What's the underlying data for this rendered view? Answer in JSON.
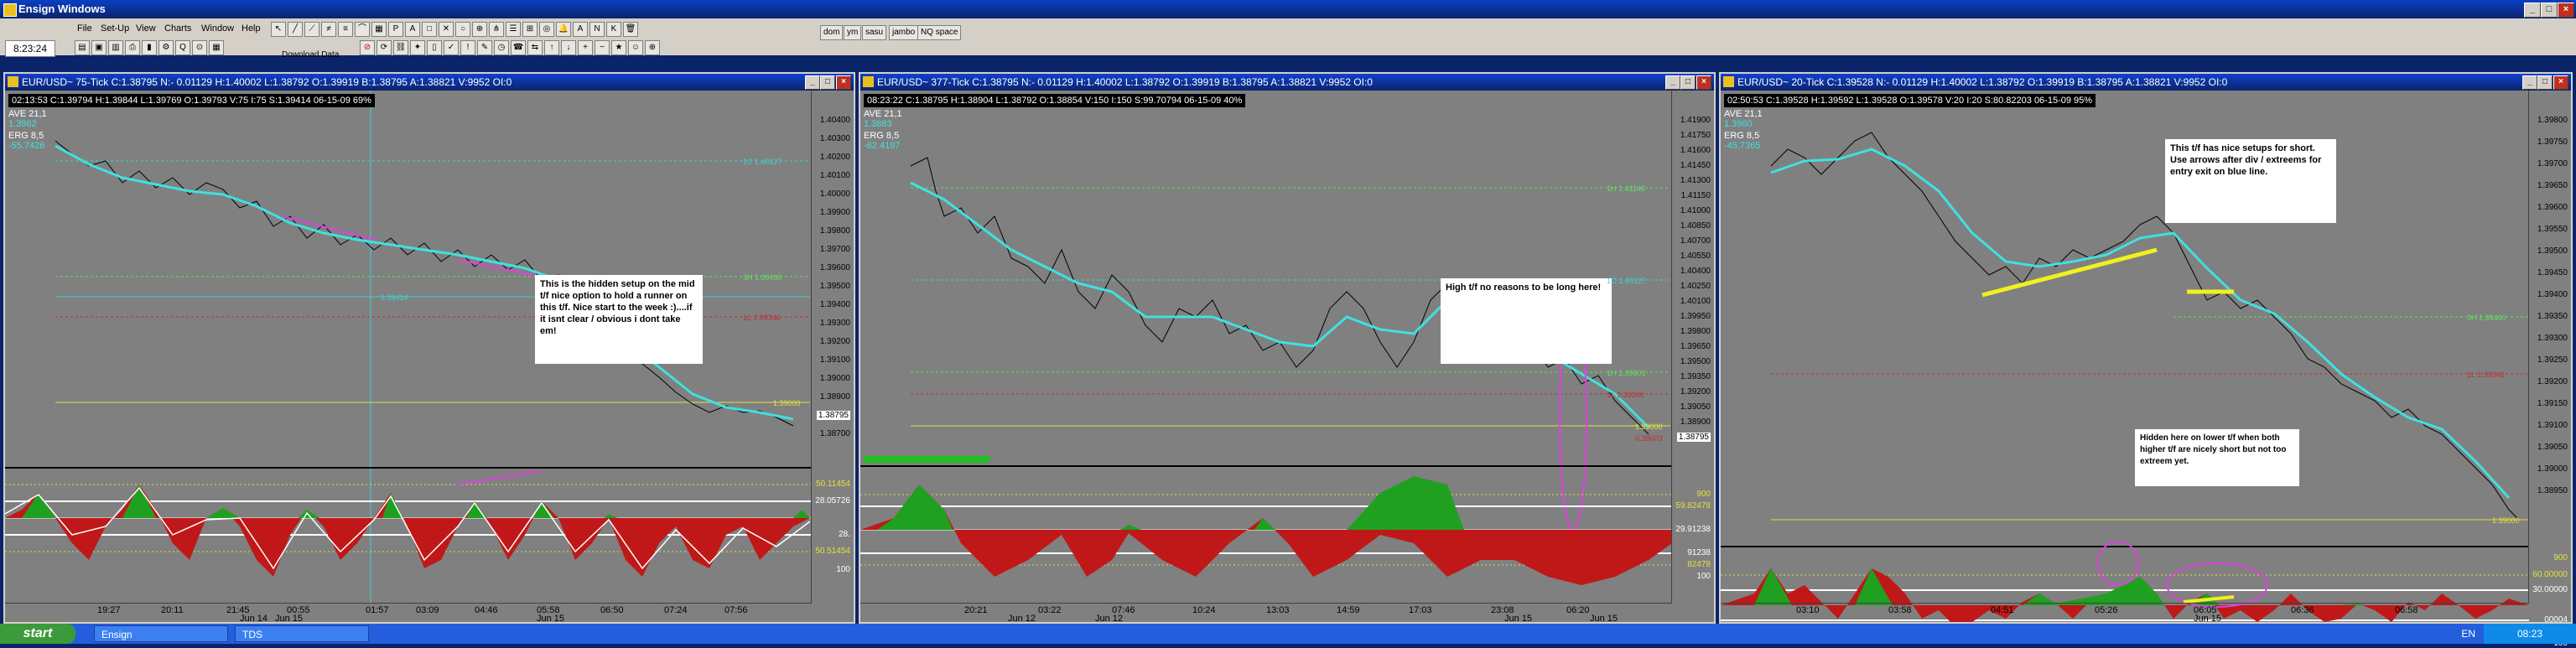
{
  "app": {
    "title": "Ensign Windows",
    "clock": "8:23:24",
    "download_label": "Download Data"
  },
  "menu": [
    "File",
    "Set-Up",
    "View",
    "Charts",
    "Window",
    "Help"
  ],
  "toolbar_tabs": [
    "dom",
    "ym",
    "sasu",
    "jambo",
    "NQ space"
  ],
  "toolbar_letters": [
    "A",
    "N",
    "K",
    "P"
  ],
  "charts": [
    {
      "title": "EUR/USD~ 75-Tick C:1.38795 N:- 0.01129 H:1.40002 L:1.38792 O:1.39919 B:1.38795 A:1.38821 V:9952 OI:0",
      "info": "02:13:53  C:1.39794  H:1.39844  L:1.39769  O:1.39793  V:75  I:75  S:1.39414  06-15-09   69%",
      "ave_label": "AVE 21,1",
      "ave_value": "1.3962",
      "erg_label": "ERG 8,5",
      "erg_value": "-55.7426",
      "prices": [
        "1.40400",
        "1.40300",
        "1.40200",
        "1.40100",
        "1.40000",
        "1.39900",
        "1.39800",
        "1.39700",
        "1.39600",
        "1.39500",
        "1.39400",
        "1.39300",
        "1.39200",
        "1.39100",
        "1.39000",
        "1.38900",
        "1.38795",
        "1.38700"
      ],
      "osc_labels": [
        "50.11454",
        "28.05726",
        "28.",
        "50.51454",
        "100"
      ],
      "xticks": [
        "19:27",
        "20:11",
        "21:45",
        "00:55",
        "01:57",
        "03:09",
        "04:46",
        "05:58",
        "06:50",
        "07:24",
        "07:56"
      ],
      "xsubs": [
        "Jun 14",
        "Jun 15",
        "Jun 15"
      ],
      "levels": [
        "1C 1.40127",
        "1.39414",
        "3H 1.39460",
        "1L 1.39346",
        "1.39000"
      ],
      "note": "This is the hidden setup on the mid t/f nice option to hold a runner on this t/f. Nice start to the week :)....if it isnt clear / obvious i dont take em!"
    },
    {
      "title": "EUR/USD~ 377-Tick C:1.38795 N:- 0.01129 H:1.40002 L:1.38792 O:1.39919 B:1.38795 A:1.38821 V:9952 OI:0",
      "info": "08:23:22  C:1.38795  H:1.38904  L:1.38792  O:1.38854  V:150  I:150  S:99.70794  06-15-09   40%",
      "ave_label": "AVE 21,1",
      "ave_value": "1.3883",
      "erg_label": "ERG 8,5",
      "erg_value": "-62.4197",
      "prices": [
        "1.41900",
        "1.41750",
        "1.41600",
        "1.41450",
        "1.41300",
        "1.41150",
        "1.41000",
        "1.40850",
        "1.40700",
        "1.40550",
        "1.40400",
        "1.40250",
        "1.40100",
        "1.39950",
        "1.39800",
        "1.39650",
        "1.39500",
        "1.39350",
        "1.39200",
        "1.39050",
        "1.38900",
        "1.38795"
      ],
      "osc_labels": [
        "900",
        "59.82478",
        "29.91238",
        "91238",
        "82478",
        "100"
      ],
      "xticks": [
        "20:21",
        "03:22",
        "07:46",
        "10:24",
        "13:03",
        "14:59",
        "17:03",
        "23:08",
        "06:20"
      ],
      "xsubs": [
        "Jun 12",
        "Jun 12",
        "Jun 15",
        "Jun 15"
      ],
      "levels": [
        "1H 1.41146",
        "1C 1.40127",
        "1H 1.39601",
        "1L 1.39346",
        "1.39000",
        "0.38603"
      ],
      "note": "High t/f no reasons to be long here!"
    },
    {
      "title": "EUR/USD~ 20-Tick C:1.39528 N:- 0.01129 H:1.40002 L:1.38792 O:1.39919 B:1.38795 A:1.38821 V:9952 OI:0",
      "info": "02:50:53  C:1.39528  H:1.39592  L:1.39528  O:1.39578  V:20  I:20  S:80.82203  06-15-09   95%",
      "ave_label": "AVE 21,1",
      "ave_value": "1.3960",
      "erg_label": "ERG 8,5",
      "erg_value": "-45.7365",
      "prices": [
        "1.39800",
        "1.39750",
        "1.39700",
        "1.39650",
        "1.39600",
        "1.39550",
        "1.39500",
        "1.39450",
        "1.39400",
        "1.39350",
        "1.39300",
        "1.39250",
        "1.39200",
        "1.39150",
        "1.39100",
        "1.39050",
        "1.39000",
        "1.38950"
      ],
      "osc_labels": [
        "900",
        "60.00000",
        "30.00000",
        "00004",
        "00004",
        "100"
      ],
      "xticks": [
        "03:10",
        "03:58",
        "04:51",
        "05:26",
        "06:05",
        "06:36",
        "06:58"
      ],
      "xsubs": [
        "Jun 15"
      ],
      "levels": [
        "3H 1.39460",
        "1L 1.39346",
        "1.39000"
      ],
      "note": "This t/f has nice setups for short. Use arrows after div / extreems for entry exit on blue line.",
      "note2": "Hidden here on lower t/f when both higher t/f are nicely short but not too extreem yet."
    }
  ],
  "taskbar": {
    "start": "start",
    "tasks": [
      "Ensign",
      "TDS"
    ],
    "lang": "EN",
    "time": "08:23"
  }
}
